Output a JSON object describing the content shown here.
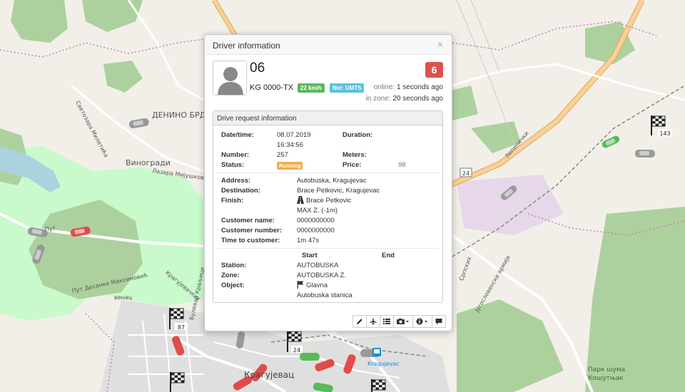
{
  "map": {
    "places": {
      "denino_brdo": "ДЕНИНО БРДО",
      "vinogradi": "Виногради",
      "kragujevac": "Крагујевац",
      "park": "Парк шума",
      "park2": "Кошутњак",
      "kragujevac_rail": "Kragujevac",
      "street_svet": "Светозара Милетића",
      "street_lazara": "Лазара Мијушковића",
      "street_put": "Пут",
      "street_desanke": "Пут Десанке Максимовић",
      "street_venac": "венац",
      "street_bulevar": "Булевар Краљице",
      "street_kraguj": "Крагујевачких",
      "street_lepenicki": "Лепенички",
      "street_srpskih": "Српских",
      "street_jug": "Југословенске армије"
    },
    "road_badge": "24",
    "flag_counts": [
      "143",
      "87",
      "24"
    ],
    "colors": {
      "land": "#f2efe9",
      "park": "#add19e",
      "park_light": "#c8facc",
      "water": "#aad3df",
      "road": "#f8d09a",
      "road_stroke": "#e3a64d"
    }
  },
  "popup": {
    "title": "Driver information",
    "close": "×",
    "driver_id": "06",
    "plate": "KG 0000-TX",
    "speed": "22 km/h",
    "net": "Net: UMTS",
    "count": "6",
    "online_label": "online:",
    "online_value": "1 seconds ago",
    "inzone_label": "in zone:",
    "inzone_value": "20 seconds ago",
    "panel_title": "Drive request information",
    "fields": {
      "datetime_label": "Date/time:",
      "date_value": "08.07.2019",
      "time_value": "16:34:56",
      "duration_label": "Duration:",
      "number_label": "Number:",
      "number_value": "257",
      "meters_label": "Meters:",
      "status_label": "Status:",
      "status_value": "Running",
      "price_label": "Price:",
      "price_value": "98",
      "address_label": "Address:",
      "address_value": "Autobuska, Kragujevac",
      "destination_label": "Destination:",
      "destination_value": "Brace Petkovic, Kragujevac",
      "finish_label": "Finish:",
      "finish_value": "Brace Petkovic",
      "finish_value2": "MAX Z. (-1m)",
      "customer_name_label": "Customer name:",
      "customer_name_value": "0000000000",
      "customer_number_label": "Customer number:",
      "customer_number_value": "0000000000",
      "time_to_customer_label": "Time to customer:",
      "time_to_customer_value": "1m 47s",
      "start_header": "Start",
      "end_header": "End",
      "station_label": "Station:",
      "station_value": "AUTOBUSKA",
      "zone_label": "Zone:",
      "zone_value": "AUTOBUSKA Z.",
      "object_label": "Object:",
      "object_value": "Glavna",
      "object_value2": "Autobuska stanica"
    },
    "toolbar": [
      "pencil-icon",
      "plane-icon",
      "list-icon",
      "camera-icon",
      "info-icon",
      "comment-icon"
    ],
    "colors": {
      "speed": "#5cb85c",
      "net": "#5bc0de",
      "count": "#d9534f",
      "running": "#f0ad4e"
    }
  }
}
